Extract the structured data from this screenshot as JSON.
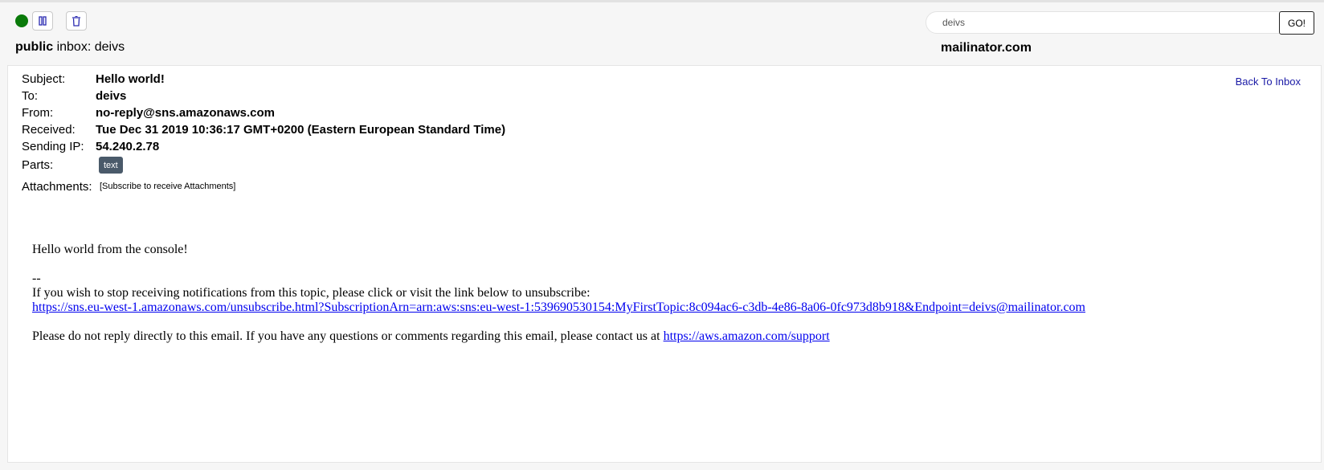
{
  "toolbar": {
    "status_color": "#0a7a0a",
    "pause_icon": "pause-icon",
    "trash_icon": "trash-icon"
  },
  "inbox": {
    "scope": "public",
    "label": "inbox:",
    "name": "deivs"
  },
  "search": {
    "value": "deivs",
    "go_label": "GO!"
  },
  "site": {
    "domain": "mailinator.com"
  },
  "message": {
    "back_label": "Back To Inbox",
    "fields": {
      "subject_label": "Subject:",
      "subject": "Hello world!",
      "to_label": "To:",
      "to": "deivs",
      "from_label": "From:",
      "from": "no-reply@sns.amazonaws.com",
      "received_label": "Received:",
      "received": "Tue Dec 31 2019 10:36:17 GMT+0200 (Eastern European Standard Time)",
      "ip_label": "Sending IP:",
      "ip": "54.240.2.78",
      "parts_label": "Parts:",
      "parts": [
        "text"
      ],
      "attachments_label": "Attachments:",
      "attachments_note": "[Subscribe to receive Attachments]"
    },
    "body": {
      "greeting": "Hello world from the console!",
      "separator": "--",
      "unsubscribe_text": "If you wish to stop receiving notifications from this topic, please click or visit the link below to unsubscribe:",
      "unsubscribe_link": "https://sns.eu-west-1.amazonaws.com/unsubscribe.html?SubscriptionArn=arn:aws:sns:eu-west-1:539690530154:MyFirstTopic:8c094ac6-c3db-4e86-8a06-0fc973d8b918&Endpoint=deivs@mailinator.com",
      "contact_text": "Please do not reply directly to this email. If you have any questions or comments regarding this email, please contact us at",
      "support_link": "https://aws.amazon.com/support"
    }
  }
}
